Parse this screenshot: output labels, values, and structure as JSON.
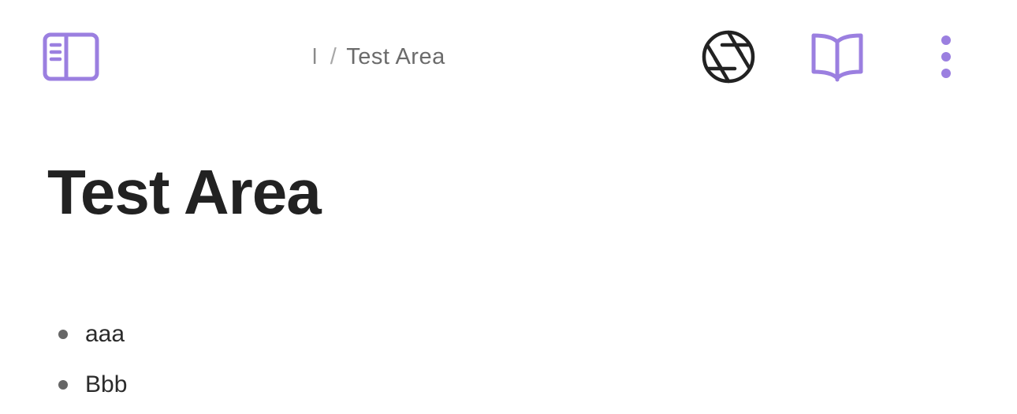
{
  "header": {
    "breadcrumb": {
      "folder": "l",
      "separator": "/",
      "current": "Test Area"
    },
    "icons": {
      "sidebar_toggle": "sidebar-panel-icon",
      "camera": "camera-aperture-icon",
      "reading_mode": "open-book-icon",
      "more_options": "vertical-ellipsis-icon"
    }
  },
  "page": {
    "title": "Test Area",
    "bullets": [
      "aaa",
      "Bbb"
    ]
  },
  "colors": {
    "accent": "#9b7fe0",
    "icon_dark": "#222222",
    "text_muted": "#6b6b6b"
  }
}
